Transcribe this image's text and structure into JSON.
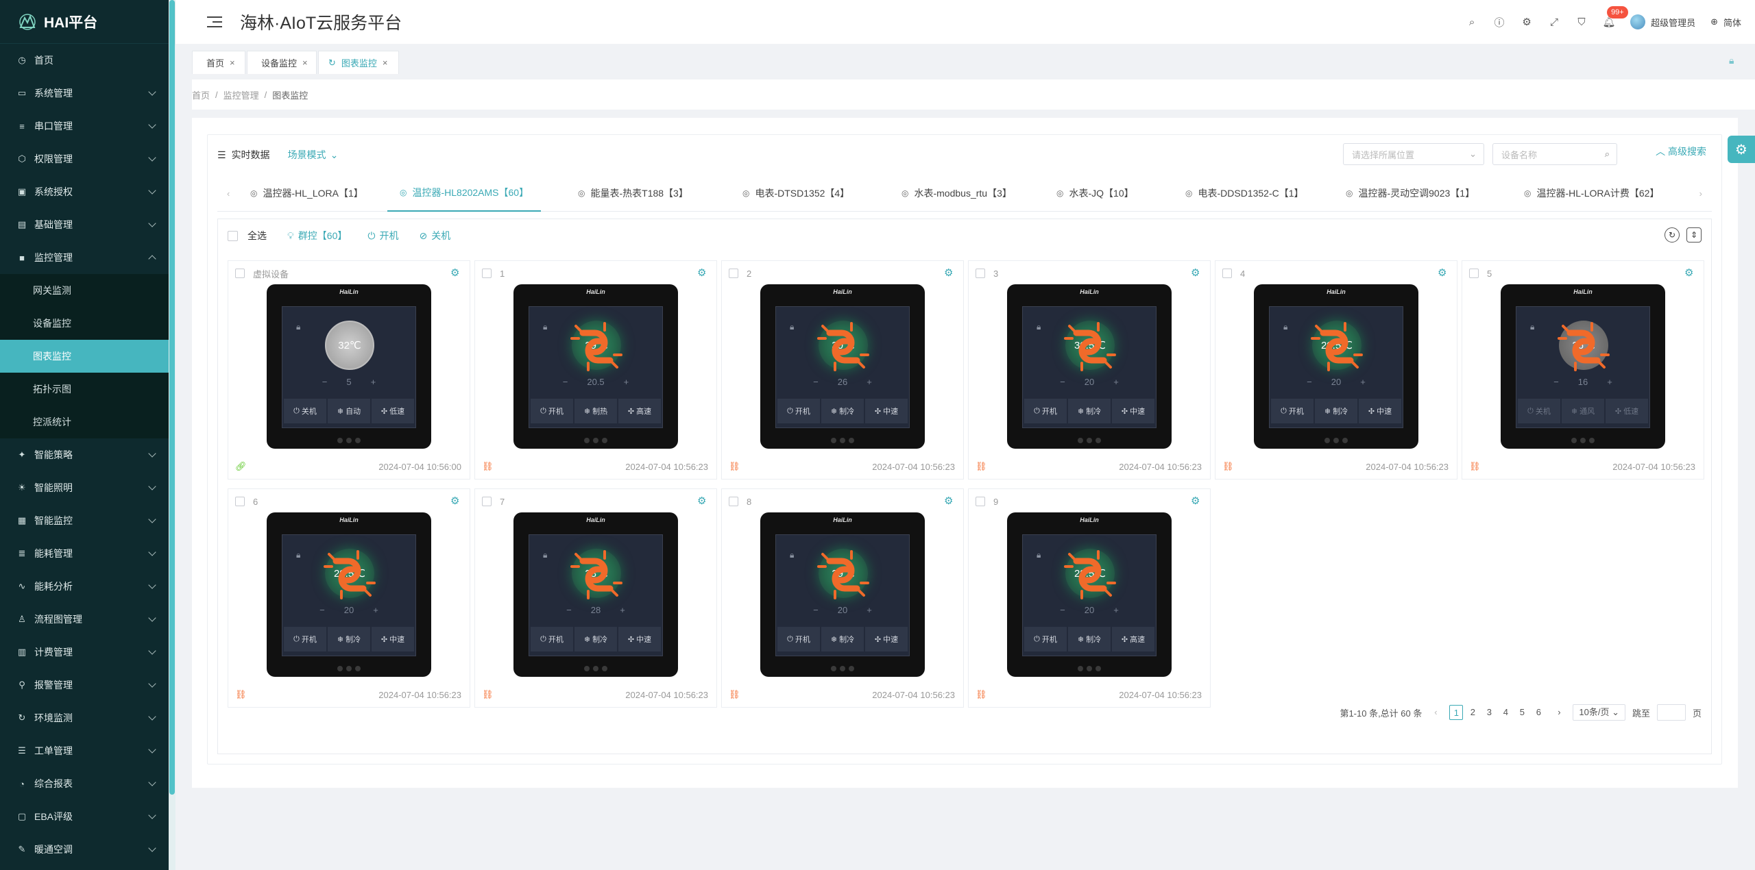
{
  "app": {
    "logo_text": "HAI平台",
    "title": "海林·AIoT云服务平台"
  },
  "header": {
    "notif_badge": "99+",
    "user": "超级管理员",
    "lang": "简体"
  },
  "sidebar": {
    "items": [
      {
        "label": "首页",
        "icon": "◷",
        "chev": false
      },
      {
        "label": "系统管理",
        "icon": "▭",
        "chev": true
      },
      {
        "label": "串口管理",
        "icon": "≡",
        "chev": true
      },
      {
        "label": "权限管理",
        "icon": "⬡",
        "chev": true
      },
      {
        "label": "系统授权",
        "icon": "▣",
        "chev": true
      },
      {
        "label": "基础管理",
        "icon": "▤",
        "chev": true
      }
    ],
    "open_group": {
      "label": "监控管理",
      "icon": "■"
    },
    "sub_items": [
      {
        "label": "网关监测"
      },
      {
        "label": "设备监控"
      },
      {
        "label": "图表监控",
        "active": true
      },
      {
        "label": "拓扑示图"
      },
      {
        "label": "控派统计"
      }
    ],
    "items_after": [
      {
        "label": "智能策略",
        "icon": "✦"
      },
      {
        "label": "智能照明",
        "icon": "☀"
      },
      {
        "label": "智能监控",
        "icon": "▦"
      },
      {
        "label": "能耗管理",
        "icon": "≣"
      },
      {
        "label": "能耗分析",
        "icon": "∿"
      },
      {
        "label": "流程图管理",
        "icon": "♙"
      },
      {
        "label": "计费管理",
        "icon": "▥"
      },
      {
        "label": "报警管理",
        "icon": "⚲"
      },
      {
        "label": "环境监测",
        "icon": "↻"
      },
      {
        "label": "工单管理",
        "icon": "☰"
      },
      {
        "label": "综合报表",
        "icon": "◔"
      },
      {
        "label": "EBA评级",
        "icon": "▢"
      },
      {
        "label": "暖通空调",
        "icon": "✎"
      }
    ]
  },
  "page_tabs": [
    {
      "label": "首页"
    },
    {
      "label": "设备监控"
    },
    {
      "label": "图表监控",
      "active": true
    }
  ],
  "breadcrumb": [
    "首页",
    "监控管理",
    "图表监控"
  ],
  "toolbar": {
    "realtime": "实时数据",
    "mode": "场景模式",
    "location_placeholder": "请选择所属位置",
    "name_placeholder": "设备名称",
    "advanced": "高级搜索"
  },
  "device_tabs": [
    {
      "label": "温控器-HL_LORA【1】"
    },
    {
      "label": "温控器-HL8202AMS【60】",
      "active": true
    },
    {
      "label": "能量表-热表T188【3】"
    },
    {
      "label": "电表-DTSD1352【4】"
    },
    {
      "label": "水表-modbus_rtu【3】"
    },
    {
      "label": "水表-JQ【10】"
    },
    {
      "label": "电表-DDSD1352-C【1】"
    },
    {
      "label": "温控器-灵动空调9023【1】"
    },
    {
      "label": "温控器-HL-LORA计费【62】"
    }
  ],
  "actions": {
    "select_all": "全选",
    "group_control": "群控【60】",
    "power_on": "开机",
    "power_off": "关机"
  },
  "devices": [
    {
      "name": "虚拟设备",
      "temp": "32℃",
      "set": "5",
      "btns": [
        "关机",
        "自动",
        "低速"
      ],
      "time": "2024-07-04 10:56:00",
      "state": "ok",
      "dial": "off",
      "broken": false
    },
    {
      "name": "1",
      "temp": "29℃",
      "set": "20.5",
      "btns": [
        "开机",
        "制热",
        "高速"
      ],
      "time": "2024-07-04 10:56:23",
      "state": "off",
      "dial": "on",
      "broken": true
    },
    {
      "name": "2",
      "temp": "30℃",
      "set": "26",
      "btns": [
        "开机",
        "制冷",
        "中速"
      ],
      "time": "2024-07-04 10:56:23",
      "state": "off",
      "dial": "on",
      "broken": true
    },
    {
      "name": "3",
      "temp": "30.5℃",
      "set": "20",
      "btns": [
        "开机",
        "制冷",
        "中速"
      ],
      "time": "2024-07-04 10:56:23",
      "state": "off",
      "dial": "on",
      "broken": true
    },
    {
      "name": "4",
      "temp": "29.5℃",
      "set": "20",
      "btns": [
        "开机",
        "制冷",
        "中速"
      ],
      "time": "2024-07-04 10:56:23",
      "state": "off",
      "dial": "on",
      "broken": true
    },
    {
      "name": "5",
      "temp": "26℃",
      "set": "16",
      "btns": [
        "关机",
        "通风",
        "低速"
      ],
      "time": "2024-07-04 10:56:23",
      "state": "off",
      "dial": "dim",
      "broken": true,
      "faded": true
    },
    {
      "name": "6",
      "temp": "29.5℃",
      "set": "20",
      "btns": [
        "开机",
        "制冷",
        "中速"
      ],
      "time": "2024-07-04 10:56:23",
      "state": "off",
      "dial": "on",
      "broken": true
    },
    {
      "name": "7",
      "temp": "28℃",
      "set": "28",
      "btns": [
        "开机",
        "制冷",
        "中速"
      ],
      "time": "2024-07-04 10:56:23",
      "state": "off",
      "dial": "on",
      "broken": true
    },
    {
      "name": "8",
      "temp": "29℃",
      "set": "20",
      "btns": [
        "开机",
        "制冷",
        "中速"
      ],
      "time": "2024-07-04 10:56:23",
      "state": "off",
      "dial": "on",
      "broken": true
    },
    {
      "name": "9",
      "temp": "28.5℃",
      "set": "20",
      "btns": [
        "开机",
        "制冷",
        "高速"
      ],
      "time": "2024-07-04 10:56:23",
      "state": "off",
      "dial": "on",
      "broken": true
    }
  ],
  "pager": {
    "summary": "第1-10 条,总计 60 条",
    "pages": [
      "1",
      "2",
      "3",
      "4",
      "5",
      "6"
    ],
    "page_size": "10条/页",
    "jump_label": "跳至",
    "page_label": "页"
  }
}
